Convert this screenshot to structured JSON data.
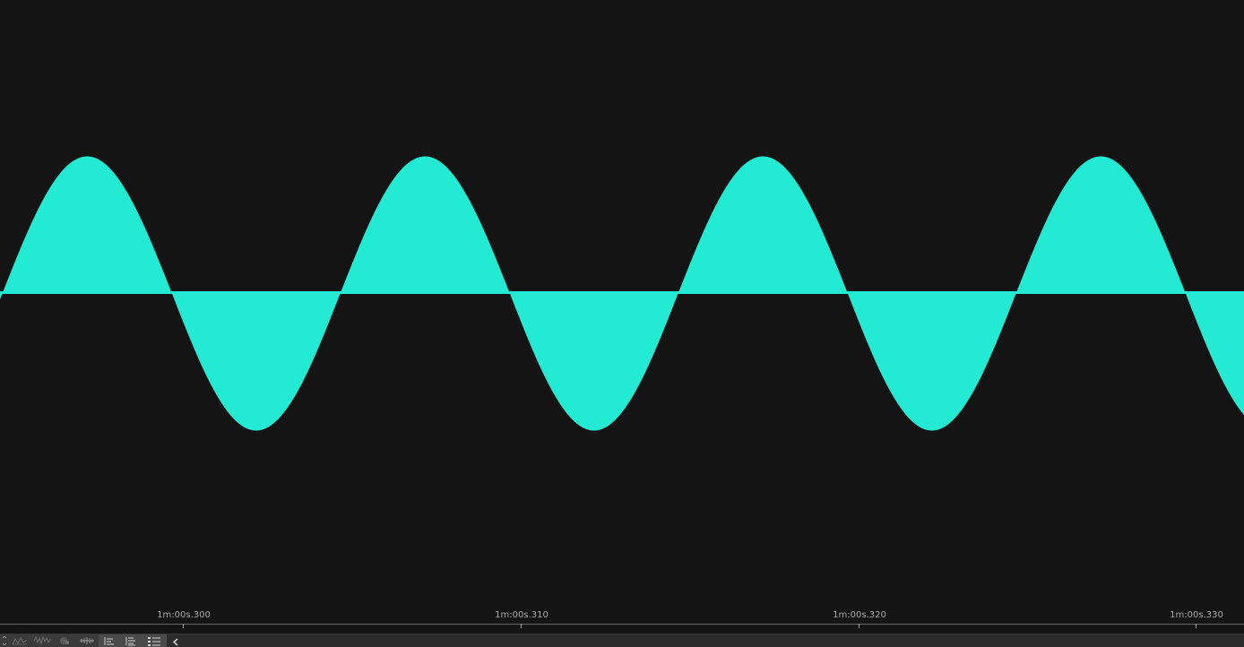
{
  "colors": {
    "background": "#141414",
    "waveform": "#22ead3",
    "ruler_text": "#a8a8a8",
    "toolbar": "#2c2c2c"
  },
  "waveform": {
    "cycles_visible": 3.67,
    "peak_amplitude": 0.55,
    "trough_amplitude": 0.55
  },
  "ruler": {
    "ticks": [
      {
        "label": "1m:00s.300"
      },
      {
        "label": "1m:00s.310"
      },
      {
        "label": "1m:00s.320"
      },
      {
        "label": "1m:00s.330"
      }
    ]
  },
  "toolbar": {
    "icons": [
      {
        "name": "envelope-tool-icon"
      },
      {
        "name": "pitch-tool-icon"
      },
      {
        "name": "spectral-tool-icon"
      },
      {
        "name": "record-toggle-icon"
      },
      {
        "name": "waveform-zoom-icon"
      },
      {
        "name": "align-left-icon"
      },
      {
        "name": "align-center-icon"
      },
      {
        "name": "list-view-icon"
      }
    ],
    "collapse_icon": "chevron-left-icon"
  }
}
